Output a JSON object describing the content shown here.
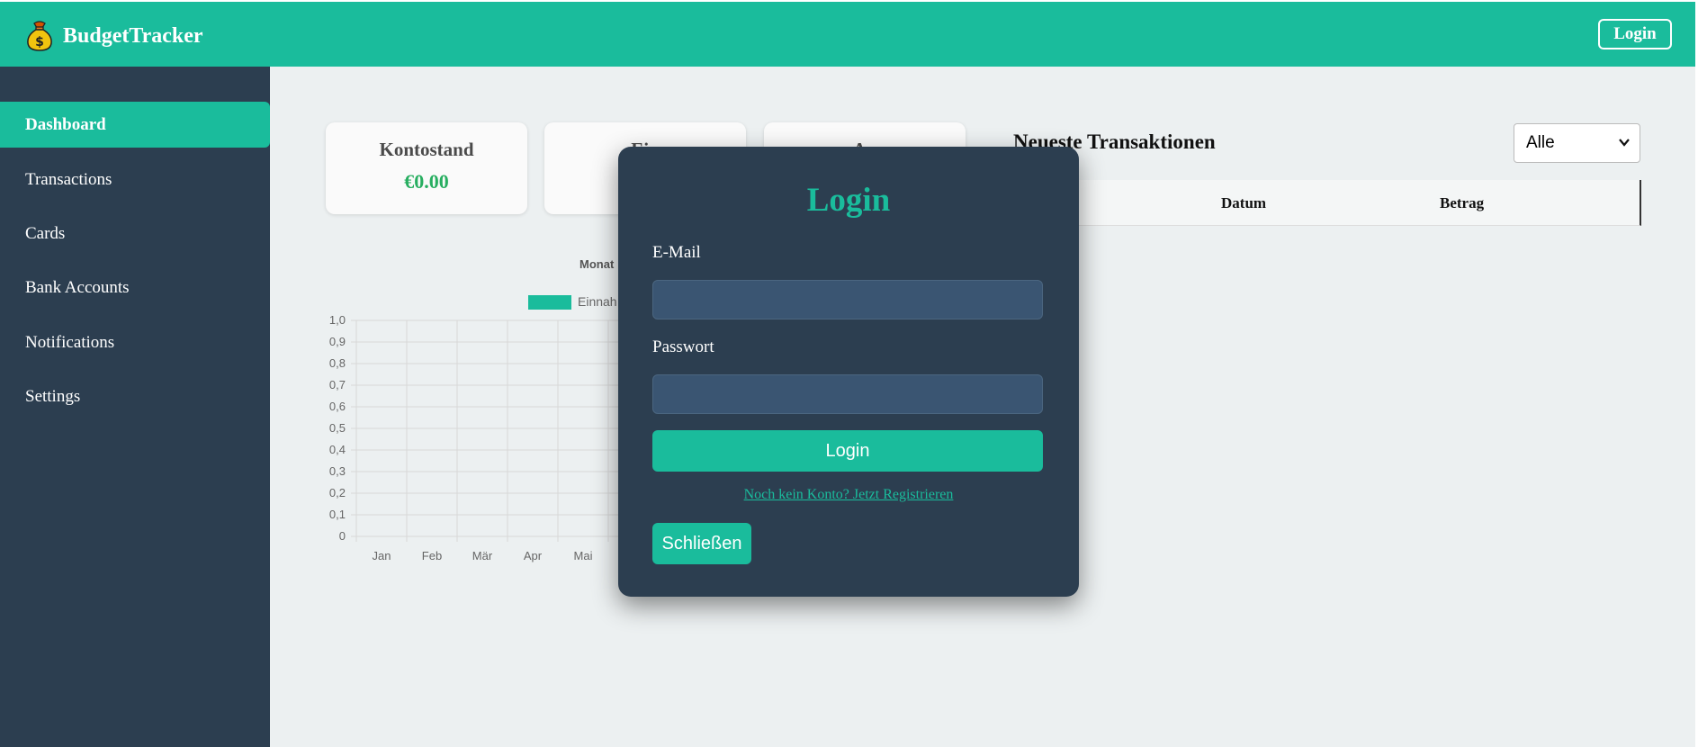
{
  "header": {
    "brand_name": "BudgetTracker",
    "brand_icon": "money-bag-icon",
    "login_label": "Login",
    "color": "#1abc9c"
  },
  "sidebar": {
    "items": [
      {
        "label": "Dashboard",
        "active": true
      },
      {
        "label": "Transactions",
        "active": false
      },
      {
        "label": "Cards",
        "active": false
      },
      {
        "label": "Bank Accounts",
        "active": false
      },
      {
        "label": "Notifications",
        "active": false
      },
      {
        "label": "Settings",
        "active": false
      }
    ],
    "color": "#2c3e50"
  },
  "summary_cards": [
    {
      "title": "Kontostand",
      "value": "€0.00"
    },
    {
      "title": "Ein",
      "value": ""
    },
    {
      "title": "Au",
      "value": ""
    }
  ],
  "chart": {
    "title": "Monat",
    "legend_label": "Einnah",
    "color": "#1abc9c"
  },
  "chart_data": {
    "type": "bar",
    "title": "Monat",
    "categories": [
      "Jan",
      "Feb",
      "Mär",
      "Apr",
      "Mai"
    ],
    "series": [
      {
        "name": "Einnah",
        "values": [
          0,
          0,
          0,
          0,
          0
        ]
      }
    ],
    "yticks": [
      "1,0",
      "0,9",
      "0,8",
      "0,7",
      "0,6",
      "0,5",
      "0,4",
      "0,3",
      "0,2",
      "0,1",
      "0"
    ],
    "ylim": [
      0,
      1
    ],
    "grid": true,
    "legend": "top"
  },
  "transactions": {
    "title": "Neueste Transaktionen",
    "filter_value": "Alle",
    "columns": [
      "Datum",
      "Betrag"
    ]
  },
  "login_modal": {
    "title": "Login",
    "email_label": "E-Mail",
    "email_value": "",
    "password_label": "Passwort",
    "password_value": "",
    "submit_label": "Login",
    "register_link": "Noch kein Konto? Jetzt Registrieren",
    "close_label": "Schließen"
  }
}
